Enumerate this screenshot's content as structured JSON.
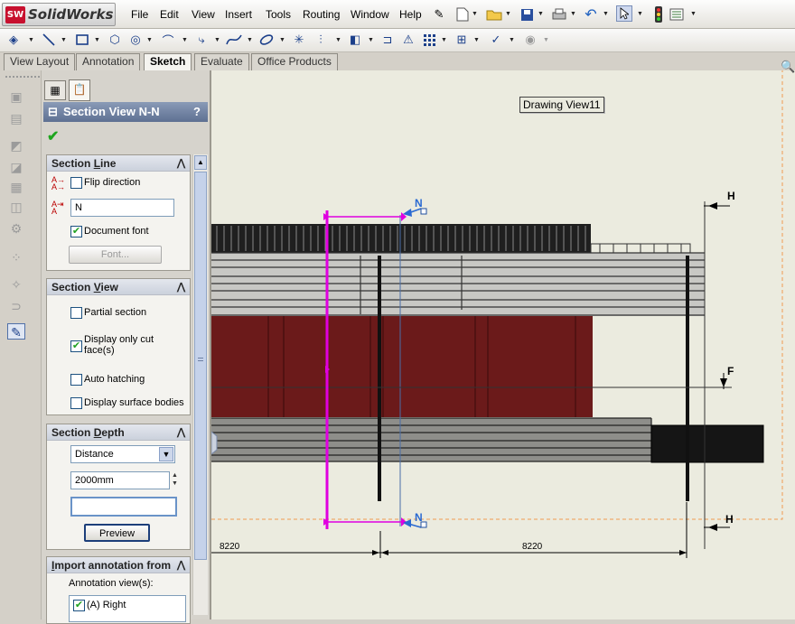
{
  "app": {
    "name": "SolidWorks",
    "logo_badge": "SW"
  },
  "menu": [
    "File",
    "Edit",
    "View",
    "Insert",
    "Tools",
    "Routing",
    "Window",
    "Help"
  ],
  "tabs": [
    {
      "label": "View Layout",
      "active": false
    },
    {
      "label": "Annotation",
      "active": false
    },
    {
      "label": "Sketch",
      "active": true
    },
    {
      "label": "Evaluate",
      "active": false
    },
    {
      "label": "Office Products",
      "active": false
    }
  ],
  "property_manager": {
    "title": "Section View N-N",
    "help": "?",
    "section_line": {
      "header_pre": "Section ",
      "header_u": "L",
      "header_post": "ine",
      "flip_direction": {
        "label": "Flip direction",
        "checked": false
      },
      "label_value": "N",
      "document_font": {
        "label": "Document font",
        "checked": true
      },
      "font_button": "Font..."
    },
    "section_view": {
      "header_pre": "Section ",
      "header_u": "V",
      "header_post": "iew",
      "partial_section": {
        "label": "Partial section",
        "checked": false
      },
      "display_only_cut": {
        "label": "Display only cut face(s)",
        "checked": true
      },
      "auto_hatching": {
        "label": "Auto hatching",
        "checked": false
      },
      "display_surface": {
        "label": "Display surface bodies",
        "checked": false
      }
    },
    "section_depth": {
      "header_pre": "Section ",
      "header_u": "D",
      "header_post": "epth",
      "reference": "Distance",
      "depth_value": "2000mm",
      "selection_value": "",
      "preview_button": "Preview"
    },
    "import_annotation": {
      "header_pre": "",
      "header_u": "I",
      "header_post": "mport annotation from",
      "views_label": "Annotation view(s):",
      "views": [
        {
          "label": "(A) Right",
          "checked": true
        }
      ]
    }
  },
  "canvas": {
    "view_label": "Drawing View11",
    "section_letters": {
      "top": "N",
      "bottom": "N"
    },
    "markers": {
      "h_top": "H",
      "h_bottom": "H",
      "f": "F"
    },
    "dimensions": {
      "left": "8220",
      "right": "8220"
    }
  },
  "colors": {
    "section_line": "#e000e0",
    "cut_face": "#6b1a1a",
    "sheet": "#ebebdf",
    "title_bar": "#6f81a2"
  }
}
